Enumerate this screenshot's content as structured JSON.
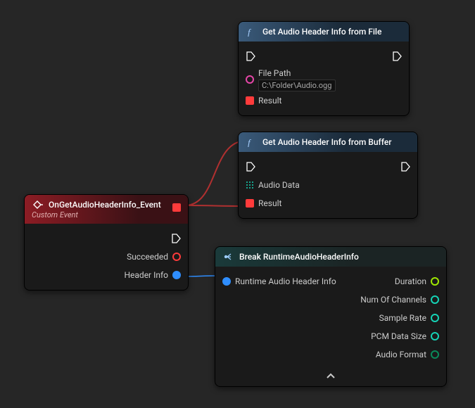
{
  "nodes": {
    "event": {
      "title": "OnGetAudioHeaderInfo_Event",
      "subtitle": "Custom Event",
      "outputs": {
        "succeeded": "Succeeded",
        "headerInfo": "Header Info"
      }
    },
    "fromFile": {
      "title": "Get Audio Header Info from File",
      "inputs": {
        "filePath": "File Path",
        "filePathValue": "C:\\Folder\\Audio.ogg",
        "result": "Result"
      }
    },
    "fromBuffer": {
      "title": "Get Audio Header Info from Buffer",
      "inputs": {
        "audioData": "Audio Data",
        "result": "Result"
      }
    },
    "break": {
      "title": "Break RuntimeAudioHeaderInfo",
      "input": "Runtime Audio Header Info",
      "outputs": {
        "duration": "Duration",
        "channels": "Num Of Channels",
        "sampleRate": "Sample Rate",
        "pcmSize": "PCM Data Size",
        "format": "Audio Format"
      }
    }
  }
}
